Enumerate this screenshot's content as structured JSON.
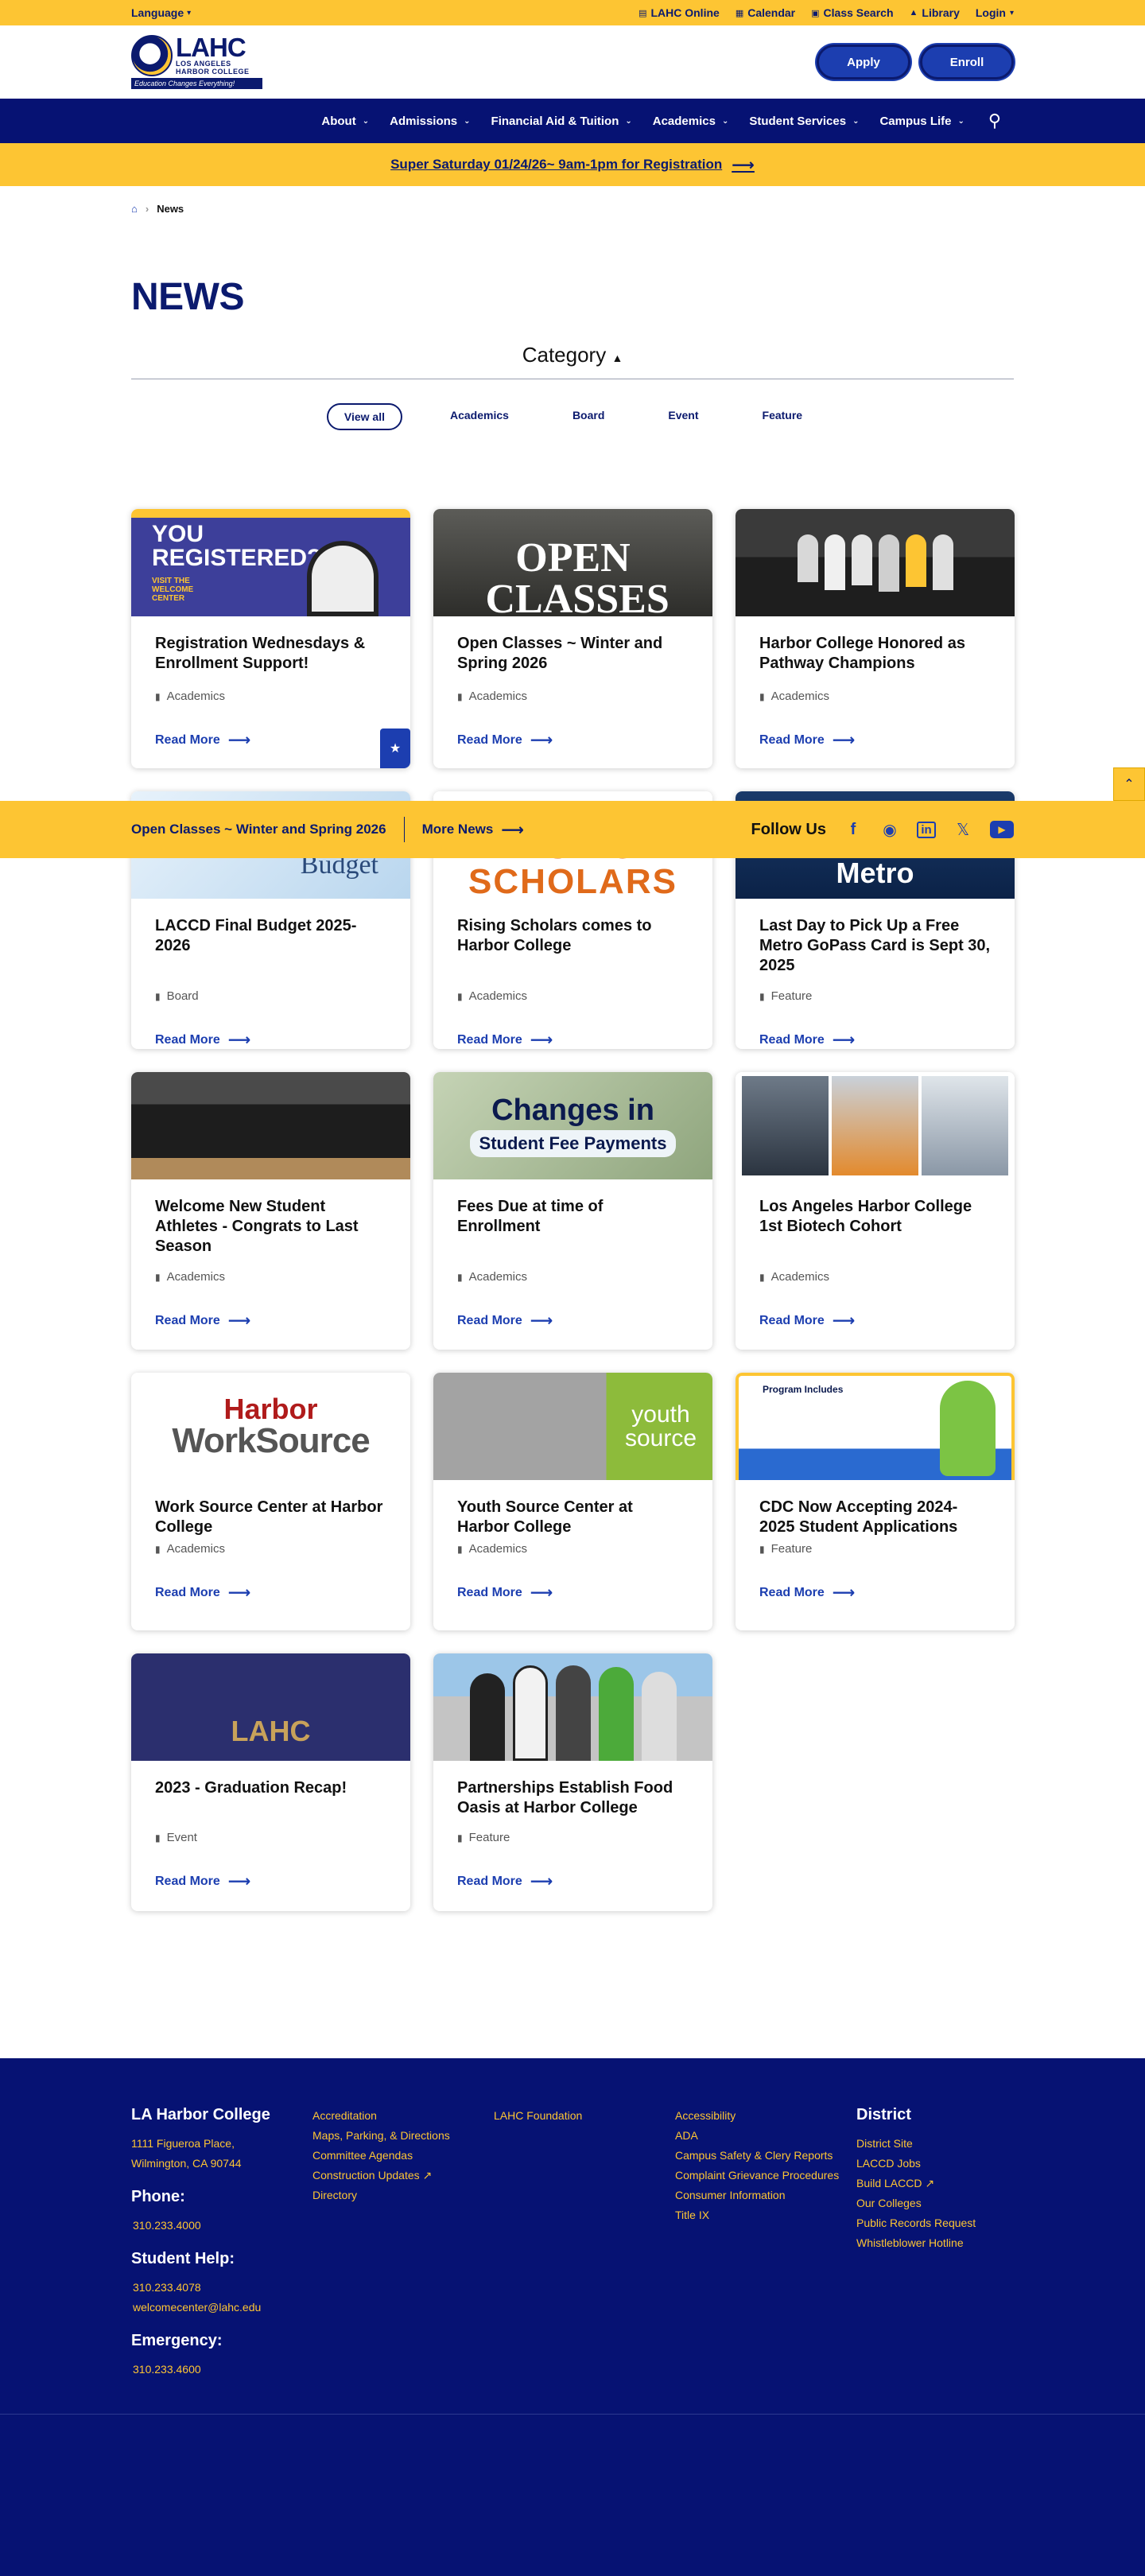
{
  "utility": {
    "language": "Language",
    "links": [
      "LAHC Online",
      "Calendar",
      "Class Search",
      "Library",
      "Login"
    ]
  },
  "logo": {
    "wordmark": "LAHC",
    "sub1": "LOS ANGELES",
    "sub2": "HARBOR COLLEGE",
    "tagline": "Education Changes Everything!"
  },
  "header": {
    "apply": "Apply",
    "enroll": "Enroll"
  },
  "nav": [
    "About",
    "Admissions",
    "Financial Aid & Tuition",
    "Academics",
    "Student Services",
    "Campus Life"
  ],
  "banner": {
    "text": "Super Saturday 01/24/26~ 9am-1pm for Registration"
  },
  "breadcrumb": {
    "current": "News"
  },
  "page_title": "NEWS",
  "category": {
    "label": "Category"
  },
  "filters": [
    "View all",
    "Academics",
    "Board",
    "Event",
    "Feature"
  ],
  "cards": [
    {
      "title": "Registration Wednesdays & Enrollment Support!",
      "category": "Academics",
      "read_more": "Read More",
      "img_text": "YOU REGISTERED?",
      "img_sub": "VISIT THE WELCOME CENTER"
    },
    {
      "title": "Open Classes ~ Winter and Spring 2026",
      "category": "Academics",
      "read_more": "Read More",
      "img_text": "OPEN CLASSES"
    },
    {
      "title": "Harbor College Honored as Pathway Champions",
      "category": "Academics",
      "read_more": "Read More"
    },
    {
      "title": "LACCD Final Budget 2025-2026",
      "category": "Board",
      "read_more": "Read More",
      "img_text": "Budget"
    },
    {
      "title": "Rising Scholars comes to Harbor College",
      "category": "Academics",
      "read_more": "Read More",
      "img_text": "RISING SCHOLARS"
    },
    {
      "title": "Last Day to Pick Up a Free Metro GoPass Card is Sept 30, 2025",
      "category": "Feature",
      "read_more": "Read More",
      "img_text": "Metro"
    },
    {
      "title": "Welcome New Student Athletes - Congrats to Last Season",
      "category": "Academics",
      "read_more": "Read More"
    },
    {
      "title": "Fees Due at time of Enrollment",
      "category": "Academics",
      "read_more": "Read More",
      "img_text": "Changes in",
      "img_sub": "Student Fee Payments"
    },
    {
      "title": "Los Angeles Harbor College 1st Biotech Cohort",
      "category": "Academics",
      "read_more": "Read More"
    },
    {
      "title": "Work Source Center at Harbor College",
      "category": "Academics",
      "read_more": "Read More",
      "img_text": "Harbor",
      "img_sub": "WorkSource"
    },
    {
      "title": "Youth Source Center at Harbor College",
      "category": "Academics",
      "read_more": "Read More",
      "img_text": "youth source"
    },
    {
      "title": "CDC Now Accepting 2024-2025 Student Applications",
      "category": "Feature",
      "read_more": "Read More",
      "img_text": "Program Includes"
    },
    {
      "title": "2023 - Graduation Recap!",
      "category": "Event",
      "read_more": "Read More",
      "img_text": "LAHC"
    },
    {
      "title": "Partnerships Establish Food Oasis at Harbor College",
      "category": "Feature",
      "read_more": "Read More"
    }
  ],
  "sticky": {
    "link1": "Open Classes ~ Winter and Spring 2026",
    "link2": "More News",
    "follow": "Follow Us"
  },
  "footer": {
    "college": "LA Harbor College",
    "addr1": "1111 Figueroa Place,",
    "addr2": "Wilmington, CA 90744",
    "phone_label": "Phone:",
    "phone": "310.233.4000",
    "help_label": "Student Help:",
    "help_phone": "310.233.4078",
    "help_email": "welcomecenter@lahc.edu",
    "emergency_label": "Emergency:",
    "emergency_phone": "310.233.4600",
    "col2": [
      "Accreditation",
      "Maps, Parking, & Directions",
      "Committee Agendas",
      "Construction Updates",
      "Directory"
    ],
    "col3": [
      "LAHC Foundation"
    ],
    "col4": [
      "Accessibility",
      "ADA",
      "Campus Safety & Clery Reports",
      "Complaint Grievance Procedures",
      "Consumer Information",
      "Title IX"
    ],
    "district_label": "District",
    "col5": [
      "District Site",
      "LACCD Jobs",
      "Build LACCD",
      "Our Colleges",
      "Public Records Request",
      "Whistleblower Hotline"
    ]
  }
}
